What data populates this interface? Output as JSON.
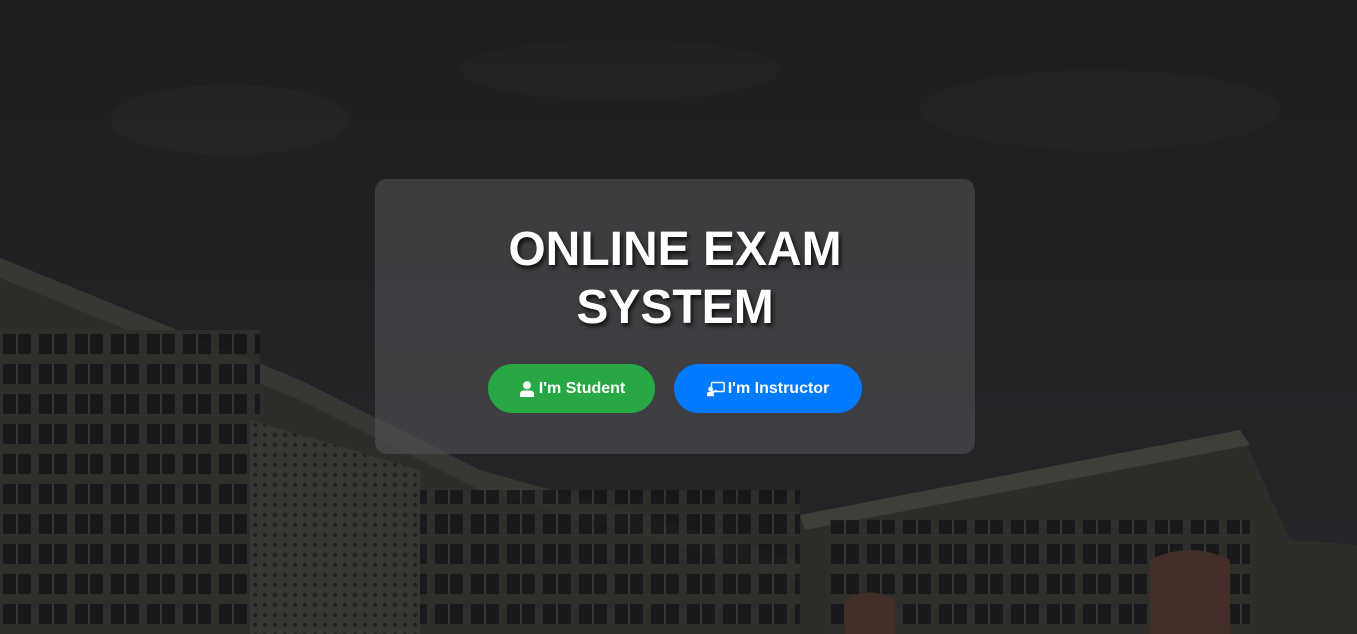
{
  "hero": {
    "title_line1": "ONLINE EXAM",
    "title_line2": "SYSTEM"
  },
  "buttons": {
    "student_label": "I'm Student",
    "student_icon": "user-icon",
    "student_color": "#28a745",
    "instructor_label": "I'm Instructor",
    "instructor_icon": "chalkboard-teacher-icon",
    "instructor_color": "#007bff"
  }
}
